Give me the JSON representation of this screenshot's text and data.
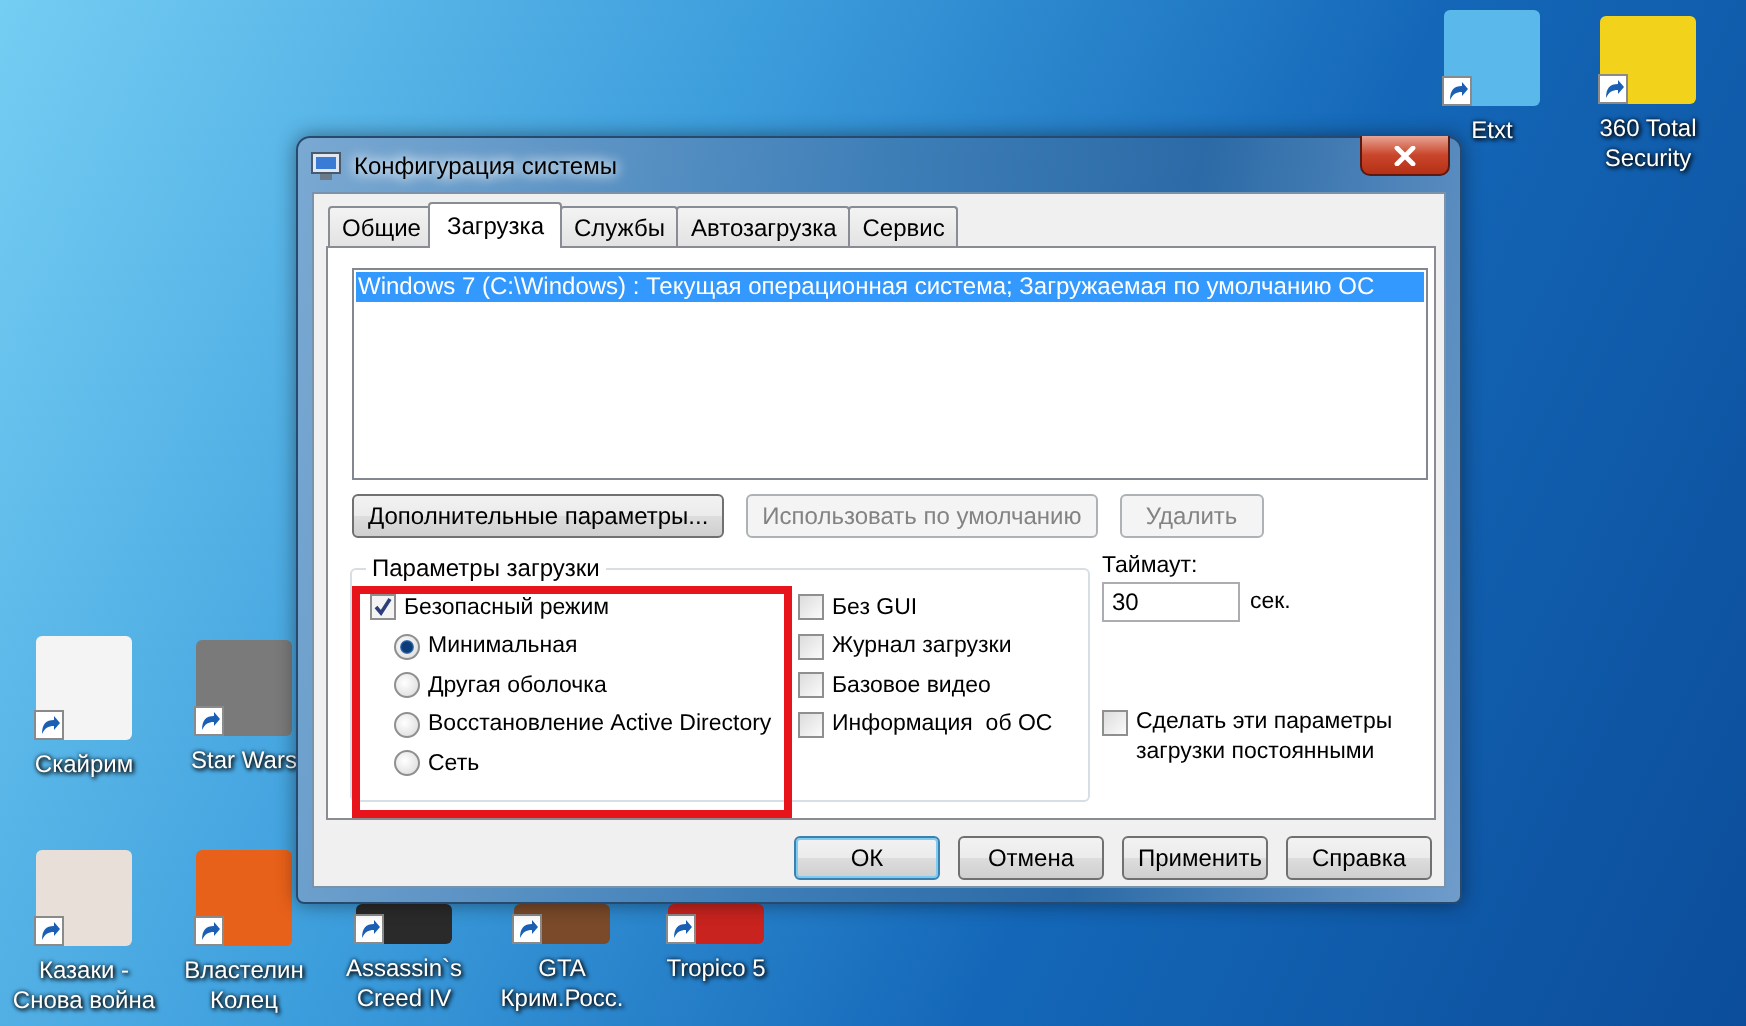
{
  "desktop_icons": [
    {
      "label": "Etxt"
    },
    {
      "label": "360 Total Security"
    },
    {
      "label": "Скайрим"
    },
    {
      "label": "Star Wars"
    },
    {
      "label": "Казаки - Снова война"
    },
    {
      "label": "Властелин Колец"
    },
    {
      "label": "Assassin`s Creed IV"
    },
    {
      "label": "GTA Крим.Росс."
    },
    {
      "label": "Tropico 5"
    }
  ],
  "window": {
    "title": "Конфигурация системы"
  },
  "tabs": [
    {
      "label": "Общие",
      "selected": false
    },
    {
      "label": "Загрузка",
      "selected": true
    },
    {
      "label": "Службы",
      "selected": false
    },
    {
      "label": "Автозагрузка",
      "selected": false
    },
    {
      "label": "Сервис",
      "selected": false
    }
  ],
  "boot_entries": [
    {
      "text": "Windows 7 (C:\\Windows) : Текущая операционная система; Загружаемая по умолчанию ОС",
      "selected": true
    }
  ],
  "entry_buttons": [
    {
      "label": "Дополнительные параметры...",
      "disabled": false
    },
    {
      "label": "Использовать по умолчанию",
      "disabled": true
    },
    {
      "label": "Удалить",
      "disabled": true
    }
  ],
  "boot_options": {
    "title": "Параметры загрузки",
    "safe_mode": {
      "label": "Безопасный режим",
      "checked": true
    },
    "safe_mode_options": [
      {
        "label": "Минимальная",
        "selected": true
      },
      {
        "label": "Другая оболочка",
        "selected": false
      },
      {
        "label": "Восстановление Active Directory",
        "selected": false
      },
      {
        "label": "Сеть",
        "selected": false
      }
    ],
    "extra_options": [
      {
        "label": "Без GUI",
        "checked": false
      },
      {
        "label": "Журнал загрузки",
        "checked": false
      },
      {
        "label": "Базовое видео",
        "checked": false
      },
      {
        "label": "Информация  об ОС",
        "checked": false
      }
    ]
  },
  "timeout": {
    "label": "Таймаут:",
    "value": "30",
    "unit": "сек."
  },
  "make_permanent": {
    "label": "Сделать эти параметры загрузки постоянными",
    "checked": false
  },
  "dialog_buttons": [
    {
      "label": "ОК",
      "default": true
    },
    {
      "label": "Отмена",
      "default": false
    },
    {
      "label": "Применить",
      "default": false
    },
    {
      "label": "Справка",
      "default": false
    }
  ]
}
